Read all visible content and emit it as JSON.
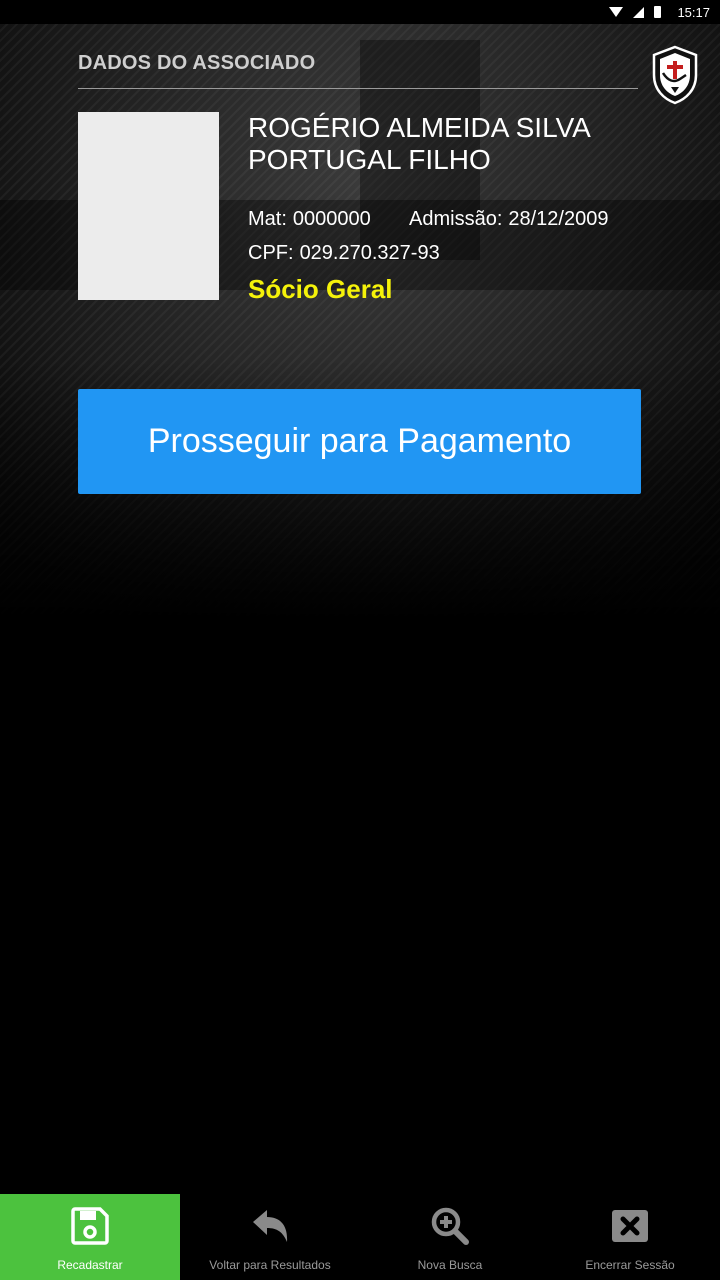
{
  "status_bar": {
    "time": "15:17",
    "icons": [
      "wifi-icon",
      "signal-icon",
      "battery-icon"
    ]
  },
  "header": {
    "title": "DADOS DO ASSOCIADO",
    "logo": "club-crest-logo"
  },
  "member": {
    "name": "ROGÉRIO ALMEIDA SILVA PORTUGAL FILHO",
    "mat_label": "Mat:",
    "mat_value": "0000000",
    "admissao_label": "Admissão:",
    "admissao_value": "28/12/2009",
    "cpf_label": "CPF:",
    "cpf_value": "029.270.327-93",
    "category": "Sócio Geral"
  },
  "actions": {
    "pay_label": "Prosseguir para Pagamento"
  },
  "bottom_nav": {
    "items": [
      {
        "label": "Recadastrar",
        "icon": "save-icon",
        "active": true
      },
      {
        "label": "Voltar para Resultados",
        "icon": "reply-icon",
        "active": false
      },
      {
        "label": "Nova Busca",
        "icon": "zoom-in-icon",
        "active": false
      },
      {
        "label": "Encerrar Sessão",
        "icon": "close-square-icon",
        "active": false
      }
    ]
  },
  "colors": {
    "accent_blue": "#2196f3",
    "active_green": "#4cc23e",
    "category_yellow": "#f5f20a",
    "background": "#000000"
  }
}
